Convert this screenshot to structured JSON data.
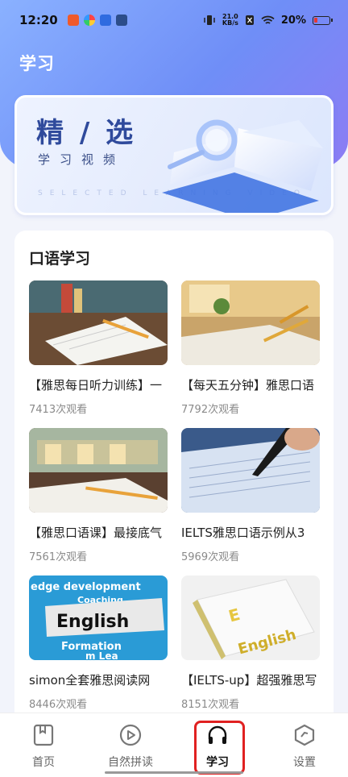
{
  "status_bar": {
    "time": "12:20",
    "net_speed_value": "21.0",
    "net_speed_unit": "KB/s",
    "battery_percent": "20%"
  },
  "page": {
    "title": "学习"
  },
  "banner": {
    "title": "精 / 选",
    "subtitle": "学习视频",
    "english": "SELECTED LEARNING VIDEO"
  },
  "section": {
    "title": "口语学习"
  },
  "courses": [
    {
      "title": "【雅思每日听力训练】一",
      "views": "7413次观看"
    },
    {
      "title": "【每天五分钟】雅思口语",
      "views": "7792次观看"
    },
    {
      "title": "【雅思口语课】最接底气",
      "views": "7561次观看"
    },
    {
      "title": "IELTS雅思口语示例从3",
      "views": "5969次观看"
    },
    {
      "title": "simon全套雅思阅读网",
      "views": "8446次观看"
    },
    {
      "title": "【IELTS-up】超强雅思写",
      "views": "8151次观看"
    }
  ],
  "tabs": [
    {
      "label": "首页",
      "icon": "book-icon"
    },
    {
      "label": "自然拼读",
      "icon": "play-circle-icon"
    },
    {
      "label": "学习",
      "icon": "headphones-icon"
    },
    {
      "label": "设置",
      "icon": "settings-hexagon-icon"
    }
  ],
  "colors": {
    "accent": "#6f8ef7",
    "highlight_box": "#e02121"
  }
}
